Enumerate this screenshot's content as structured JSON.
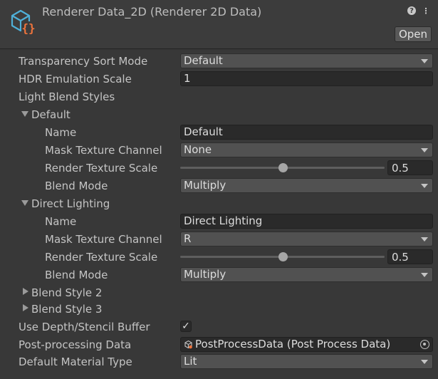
{
  "header": {
    "title": "Renderer Data_2D (Renderer 2D Data)",
    "open_label": "Open",
    "help_icon": "?",
    "settings_icon": "⋮"
  },
  "fields": {
    "transparency_sort_mode": {
      "label": "Transparency Sort Mode",
      "value": "Default"
    },
    "hdr_emulation_scale": {
      "label": "HDR Emulation Scale",
      "value": "1"
    },
    "light_blend_styles_label": "Light Blend Styles",
    "styles": [
      {
        "title": "Default",
        "name_label": "Name",
        "name_value": "Default",
        "mask_label": "Mask Texture Channel",
        "mask_value": "None",
        "scale_label": "Render Texture Scale",
        "scale_value": "0.5",
        "scale_fraction": 0.5,
        "blend_label": "Blend Mode",
        "blend_value": "Multiply"
      },
      {
        "title": "Direct Lighting",
        "name_label": "Name",
        "name_value": "Direct Lighting",
        "mask_label": "Mask Texture Channel",
        "mask_value": "R",
        "scale_label": "Render Texture Scale",
        "scale_value": "0.5",
        "scale_fraction": 0.5,
        "blend_label": "Blend Mode",
        "blend_value": "Multiply"
      }
    ],
    "blend_style_2": "Blend Style 2",
    "blend_style_3": "Blend Style 3",
    "depth_stencil": {
      "label": "Use Depth/Stencil Buffer",
      "checked": true,
      "check_glyph": "✓"
    },
    "post_processing": {
      "label": "Post-processing Data",
      "value": "PostProcessData (Post Process Data)"
    },
    "default_material": {
      "label": "Default Material Type",
      "value": "Lit"
    }
  },
  "colors": {
    "background": "#383838",
    "header": "#3c3c3c",
    "asset_icon_blue": "#4fb0d8",
    "asset_icon_orange": "#f0743c"
  }
}
